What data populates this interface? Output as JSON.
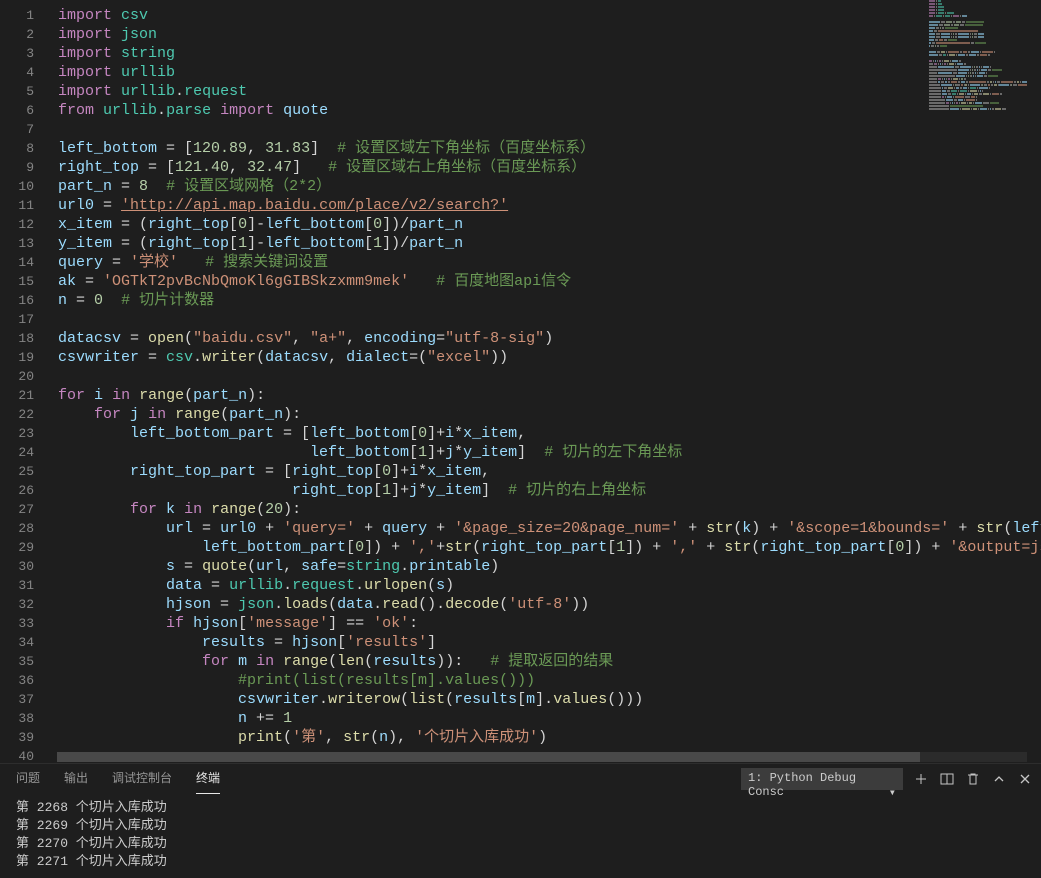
{
  "lines": [
    [
      [
        "kw",
        "import"
      ],
      [
        "pun",
        " "
      ],
      [
        "mod",
        "csv"
      ]
    ],
    [
      [
        "kw",
        "import"
      ],
      [
        "pun",
        " "
      ],
      [
        "mod",
        "json"
      ]
    ],
    [
      [
        "kw",
        "import"
      ],
      [
        "pun",
        " "
      ],
      [
        "mod",
        "string"
      ]
    ],
    [
      [
        "kw",
        "import"
      ],
      [
        "pun",
        " "
      ],
      [
        "mod",
        "urllib"
      ]
    ],
    [
      [
        "kw",
        "import"
      ],
      [
        "pun",
        " "
      ],
      [
        "mod",
        "urllib"
      ],
      [
        "pun",
        "."
      ],
      [
        "mod",
        "request"
      ]
    ],
    [
      [
        "kw",
        "from"
      ],
      [
        "pun",
        " "
      ],
      [
        "mod",
        "urllib"
      ],
      [
        "pun",
        "."
      ],
      [
        "mod",
        "parse"
      ],
      [
        "pun",
        " "
      ],
      [
        "kw",
        "import"
      ],
      [
        "pun",
        " "
      ],
      [
        "var",
        "quote"
      ]
    ],
    [],
    [
      [
        "var",
        "left_bottom"
      ],
      [
        "pun",
        " = ["
      ],
      [
        "num",
        "120.89"
      ],
      [
        "pun",
        ", "
      ],
      [
        "num",
        "31.83"
      ],
      [
        "pun",
        "]  "
      ],
      [
        "com",
        "# 设置区域左下角坐标（百度坐标系）"
      ]
    ],
    [
      [
        "var",
        "right_top"
      ],
      [
        "pun",
        " = ["
      ],
      [
        "num",
        "121.40"
      ],
      [
        "pun",
        ", "
      ],
      [
        "num",
        "32.47"
      ],
      [
        "pun",
        "]   "
      ],
      [
        "com",
        "# 设置区域右上角坐标（百度坐标系）"
      ]
    ],
    [
      [
        "var",
        "part_n"
      ],
      [
        "pun",
        " = "
      ],
      [
        "num",
        "8"
      ],
      [
        "pun",
        "  "
      ],
      [
        "com",
        "# 设置区域网格（2*2）"
      ]
    ],
    [
      [
        "var",
        "url0"
      ],
      [
        "pun",
        " = "
      ],
      [
        "str lnk",
        "'http://api.map.baidu.com/place/v2/search?'"
      ]
    ],
    [
      [
        "var",
        "x_item"
      ],
      [
        "pun",
        " = ("
      ],
      [
        "var",
        "right_top"
      ],
      [
        "pun",
        "["
      ],
      [
        "num",
        "0"
      ],
      [
        "pun",
        "]-"
      ],
      [
        "var",
        "left_bottom"
      ],
      [
        "pun",
        "["
      ],
      [
        "num",
        "0"
      ],
      [
        "pun",
        "])/"
      ],
      [
        "var",
        "part_n"
      ]
    ],
    [
      [
        "var",
        "y_item"
      ],
      [
        "pun",
        " = ("
      ],
      [
        "var",
        "right_top"
      ],
      [
        "pun",
        "["
      ],
      [
        "num",
        "1"
      ],
      [
        "pun",
        "]-"
      ],
      [
        "var",
        "left_bottom"
      ],
      [
        "pun",
        "["
      ],
      [
        "num",
        "1"
      ],
      [
        "pun",
        "])/"
      ],
      [
        "var",
        "part_n"
      ]
    ],
    [
      [
        "var",
        "query"
      ],
      [
        "pun",
        " = "
      ],
      [
        "str",
        "'学校'"
      ],
      [
        "pun",
        "   "
      ],
      [
        "com",
        "# 搜索关键词设置"
      ]
    ],
    [
      [
        "var",
        "ak"
      ],
      [
        "pun",
        " = "
      ],
      [
        "str",
        "'OGTkT2pvBcNbQmoKl6gGIBSkzxmm9mek'"
      ],
      [
        "pun",
        "   "
      ],
      [
        "com",
        "# 百度地图api信令"
      ]
    ],
    [
      [
        "var",
        "n"
      ],
      [
        "pun",
        " = "
      ],
      [
        "num",
        "0"
      ],
      [
        "pun",
        "  "
      ],
      [
        "com",
        "# 切片计数器"
      ]
    ],
    [],
    [
      [
        "var",
        "datacsv"
      ],
      [
        "pun",
        " = "
      ],
      [
        "fn",
        "open"
      ],
      [
        "pun",
        "("
      ],
      [
        "str",
        "\"baidu.csv\""
      ],
      [
        "pun",
        ", "
      ],
      [
        "str",
        "\"a+\""
      ],
      [
        "pun",
        ", "
      ],
      [
        "var",
        "encoding"
      ],
      [
        "pun",
        "="
      ],
      [
        "str",
        "\"utf-8-sig\""
      ],
      [
        "pun",
        ")"
      ]
    ],
    [
      [
        "var",
        "csvwriter"
      ],
      [
        "pun",
        " = "
      ],
      [
        "mod",
        "csv"
      ],
      [
        "pun",
        "."
      ],
      [
        "fn",
        "writer"
      ],
      [
        "pun",
        "("
      ],
      [
        "var",
        "datacsv"
      ],
      [
        "pun",
        ", "
      ],
      [
        "var",
        "dialect"
      ],
      [
        "pun",
        "=("
      ],
      [
        "str",
        "\"excel\""
      ],
      [
        "pun",
        "))"
      ]
    ],
    [],
    [
      [
        "kw",
        "for"
      ],
      [
        "pun",
        " "
      ],
      [
        "var",
        "i"
      ],
      [
        "pun",
        " "
      ],
      [
        "kw",
        "in"
      ],
      [
        "pun",
        " "
      ],
      [
        "fn",
        "range"
      ],
      [
        "pun",
        "("
      ],
      [
        "var",
        "part_n"
      ],
      [
        "pun",
        "):"
      ]
    ],
    [
      [
        "pun",
        "    "
      ],
      [
        "kw",
        "for"
      ],
      [
        "pun",
        " "
      ],
      [
        "var",
        "j"
      ],
      [
        "pun",
        " "
      ],
      [
        "kw",
        "in"
      ],
      [
        "pun",
        " "
      ],
      [
        "fn",
        "range"
      ],
      [
        "pun",
        "("
      ],
      [
        "var",
        "part_n"
      ],
      [
        "pun",
        "):"
      ]
    ],
    [
      [
        "pun",
        "        "
      ],
      [
        "var",
        "left_bottom_part"
      ],
      [
        "pun",
        " = ["
      ],
      [
        "var",
        "left_bottom"
      ],
      [
        "pun",
        "["
      ],
      [
        "num",
        "0"
      ],
      [
        "pun",
        "]+"
      ],
      [
        "var",
        "i"
      ],
      [
        "pun",
        "*"
      ],
      [
        "var",
        "x_item"
      ],
      [
        "pun",
        ","
      ]
    ],
    [
      [
        "pun",
        "                            "
      ],
      [
        "var",
        "left_bottom"
      ],
      [
        "pun",
        "["
      ],
      [
        "num",
        "1"
      ],
      [
        "pun",
        "]+"
      ],
      [
        "var",
        "j"
      ],
      [
        "pun",
        "*"
      ],
      [
        "var",
        "y_item"
      ],
      [
        "pun",
        "]  "
      ],
      [
        "com",
        "# 切片的左下角坐标"
      ]
    ],
    [
      [
        "pun",
        "        "
      ],
      [
        "var",
        "right_top_part"
      ],
      [
        "pun",
        " = ["
      ],
      [
        "var",
        "right_top"
      ],
      [
        "pun",
        "["
      ],
      [
        "num",
        "0"
      ],
      [
        "pun",
        "]+"
      ],
      [
        "var",
        "i"
      ],
      [
        "pun",
        "*"
      ],
      [
        "var",
        "x_item"
      ],
      [
        "pun",
        ","
      ]
    ],
    [
      [
        "pun",
        "                          "
      ],
      [
        "var",
        "right_top"
      ],
      [
        "pun",
        "["
      ],
      [
        "num",
        "1"
      ],
      [
        "pun",
        "]+"
      ],
      [
        "var",
        "j"
      ],
      [
        "pun",
        "*"
      ],
      [
        "var",
        "y_item"
      ],
      [
        "pun",
        "]  "
      ],
      [
        "com",
        "# 切片的右上角坐标"
      ]
    ],
    [
      [
        "pun",
        "        "
      ],
      [
        "kw",
        "for"
      ],
      [
        "pun",
        " "
      ],
      [
        "var",
        "k"
      ],
      [
        "pun",
        " "
      ],
      [
        "kw",
        "in"
      ],
      [
        "pun",
        " "
      ],
      [
        "fn",
        "range"
      ],
      [
        "pun",
        "("
      ],
      [
        "num",
        "20"
      ],
      [
        "pun",
        "):"
      ]
    ],
    [
      [
        "pun",
        "            "
      ],
      [
        "var",
        "url"
      ],
      [
        "pun",
        " = "
      ],
      [
        "var",
        "url0"
      ],
      [
        "pun",
        " + "
      ],
      [
        "str",
        "'query='"
      ],
      [
        "pun",
        " + "
      ],
      [
        "var",
        "query"
      ],
      [
        "pun",
        " + "
      ],
      [
        "str",
        "'&page_size=20&page_num='"
      ],
      [
        "pun",
        " + "
      ],
      [
        "fn",
        "str"
      ],
      [
        "pun",
        "("
      ],
      [
        "var",
        "k"
      ],
      [
        "pun",
        ") + "
      ],
      [
        "str",
        "'&scope=1&bounds='"
      ],
      [
        "pun",
        " + "
      ],
      [
        "fn",
        "str"
      ],
      [
        "pun",
        "("
      ],
      [
        "var",
        "left_bo"
      ]
    ],
    [
      [
        "pun",
        "                "
      ],
      [
        "var",
        "left_bottom_part"
      ],
      [
        "pun",
        "["
      ],
      [
        "num",
        "0"
      ],
      [
        "pun",
        "]) + "
      ],
      [
        "str",
        "','"
      ],
      [
        "pun",
        "+"
      ],
      [
        "fn",
        "str"
      ],
      [
        "pun",
        "("
      ],
      [
        "var",
        "right_top_part"
      ],
      [
        "pun",
        "["
      ],
      [
        "num",
        "1"
      ],
      [
        "pun",
        "]) + "
      ],
      [
        "str",
        "','"
      ],
      [
        "pun",
        " + "
      ],
      [
        "fn",
        "str"
      ],
      [
        "pun",
        "("
      ],
      [
        "var",
        "right_top_part"
      ],
      [
        "pun",
        "["
      ],
      [
        "num",
        "0"
      ],
      [
        "pun",
        "]) + "
      ],
      [
        "str",
        "'&output=json&"
      ]
    ],
    [
      [
        "pun",
        "            "
      ],
      [
        "var",
        "s"
      ],
      [
        "pun",
        " = "
      ],
      [
        "fn",
        "quote"
      ],
      [
        "pun",
        "("
      ],
      [
        "var",
        "url"
      ],
      [
        "pun",
        ", "
      ],
      [
        "var",
        "safe"
      ],
      [
        "pun",
        "="
      ],
      [
        "mod",
        "string"
      ],
      [
        "pun",
        "."
      ],
      [
        "var",
        "printable"
      ],
      [
        "pun",
        ")"
      ]
    ],
    [
      [
        "pun",
        "            "
      ],
      [
        "var",
        "data"
      ],
      [
        "pun",
        " = "
      ],
      [
        "mod",
        "urllib"
      ],
      [
        "pun",
        "."
      ],
      [
        "mod",
        "request"
      ],
      [
        "pun",
        "."
      ],
      [
        "fn",
        "urlopen"
      ],
      [
        "pun",
        "("
      ],
      [
        "var",
        "s"
      ],
      [
        "pun",
        ")"
      ]
    ],
    [
      [
        "pun",
        "            "
      ],
      [
        "var",
        "hjson"
      ],
      [
        "pun",
        " = "
      ],
      [
        "mod",
        "json"
      ],
      [
        "pun",
        "."
      ],
      [
        "fn",
        "loads"
      ],
      [
        "pun",
        "("
      ],
      [
        "var",
        "data"
      ],
      [
        "pun",
        "."
      ],
      [
        "fn",
        "read"
      ],
      [
        "pun",
        "()."
      ],
      [
        "fn",
        "decode"
      ],
      [
        "pun",
        "("
      ],
      [
        "str",
        "'utf-8'"
      ],
      [
        "pun",
        "))"
      ]
    ],
    [
      [
        "pun",
        "            "
      ],
      [
        "kw",
        "if"
      ],
      [
        "pun",
        " "
      ],
      [
        "var",
        "hjson"
      ],
      [
        "pun",
        "["
      ],
      [
        "str",
        "'message'"
      ],
      [
        "pun",
        "] == "
      ],
      [
        "str",
        "'ok'"
      ],
      [
        "pun",
        ":"
      ]
    ],
    [
      [
        "pun",
        "                "
      ],
      [
        "var",
        "results"
      ],
      [
        "pun",
        " = "
      ],
      [
        "var",
        "hjson"
      ],
      [
        "pun",
        "["
      ],
      [
        "str",
        "'results'"
      ],
      [
        "pun",
        "]"
      ]
    ],
    [
      [
        "pun",
        "                "
      ],
      [
        "kw",
        "for"
      ],
      [
        "pun",
        " "
      ],
      [
        "var",
        "m"
      ],
      [
        "pun",
        " "
      ],
      [
        "kw",
        "in"
      ],
      [
        "pun",
        " "
      ],
      [
        "fn",
        "range"
      ],
      [
        "pun",
        "("
      ],
      [
        "fn",
        "len"
      ],
      [
        "pun",
        "("
      ],
      [
        "var",
        "results"
      ],
      [
        "pun",
        ")):   "
      ],
      [
        "com",
        "# 提取返回的结果"
      ]
    ],
    [
      [
        "pun",
        "                    "
      ],
      [
        "com",
        "#print(list(results[m].values()))"
      ]
    ],
    [
      [
        "pun",
        "                    "
      ],
      [
        "var",
        "csvwriter"
      ],
      [
        "pun",
        "."
      ],
      [
        "fn",
        "writerow"
      ],
      [
        "pun",
        "("
      ],
      [
        "fn",
        "list"
      ],
      [
        "pun",
        "("
      ],
      [
        "var",
        "results"
      ],
      [
        "pun",
        "["
      ],
      [
        "var",
        "m"
      ],
      [
        "pun",
        "]."
      ],
      [
        "fn",
        "values"
      ],
      [
        "pun",
        "()))"
      ]
    ],
    [
      [
        "pun",
        "                    "
      ],
      [
        "var",
        "n"
      ],
      [
        "pun",
        " += "
      ],
      [
        "num",
        "1"
      ]
    ],
    [
      [
        "pun",
        "                    "
      ],
      [
        "fn",
        "print"
      ],
      [
        "pun",
        "("
      ],
      [
        "str",
        "'第'"
      ],
      [
        "pun",
        ", "
      ],
      [
        "fn",
        "str"
      ],
      [
        "pun",
        "("
      ],
      [
        "var",
        "n"
      ],
      [
        "pun",
        "), "
      ],
      [
        "str",
        "'个切片入库成功'"
      ],
      [
        "pun",
        ")"
      ]
    ],
    []
  ],
  "panel": {
    "tabs": [
      "问题",
      "输出",
      "调试控制台",
      "终端"
    ],
    "active": 3,
    "select": "1: Python Debug Consc",
    "output": [
      "第  2268  个切片入库成功",
      "第  2269  个切片入库成功",
      "第  2270  个切片入库成功",
      "第  2271  个切片入库成功"
    ]
  },
  "mm_palette": {
    "kw": "#c586c0",
    "mod": "#4ec9b0",
    "cls": "#4ec9b0",
    "var": "#9cdcfe",
    "num": "#b5cea8",
    "str": "#ce9178",
    "com": "#6a9955",
    "fn": "#dcdcaa",
    "pun": "#a9a9a9",
    "lnk": "#ce9178"
  }
}
